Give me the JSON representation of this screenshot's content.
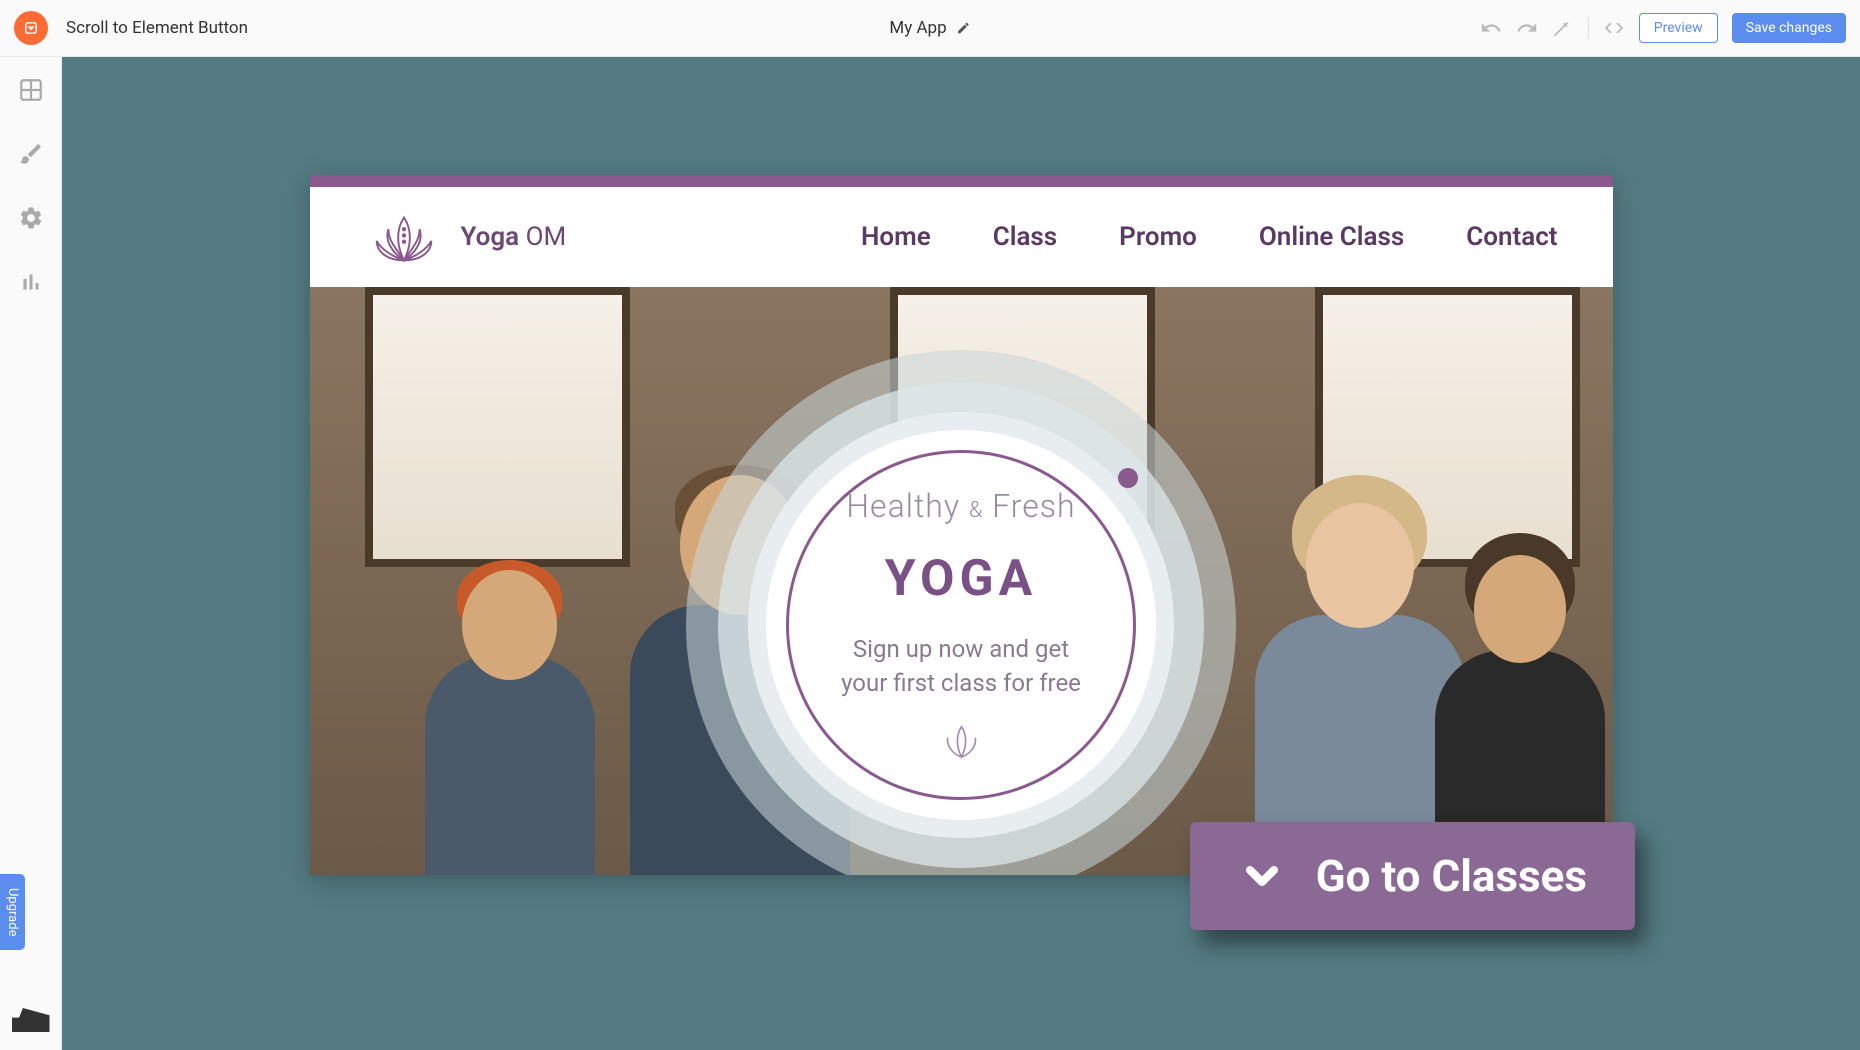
{
  "topbar": {
    "elementName": "Scroll to Element Button",
    "appName": "My App",
    "preview": "Preview",
    "save": "Save changes"
  },
  "sidebar": {
    "upgrade": "Upgrade"
  },
  "site": {
    "brand1": "Yoga",
    "brand2": "OM",
    "nav": [
      "Home",
      "Class",
      "Promo",
      "Online Class",
      "Contact"
    ],
    "hero": {
      "subtitle1": "Healthy",
      "amp": "&",
      "subtitle2": "Fresh",
      "title": "YOGA",
      "tagline1": "Sign up now and get",
      "tagline2": "your first class for free"
    },
    "cta": "Go to Classes"
  },
  "colors": {
    "purple": "#8a5a8f",
    "teal": "#547b82",
    "blue": "#5b8def"
  }
}
